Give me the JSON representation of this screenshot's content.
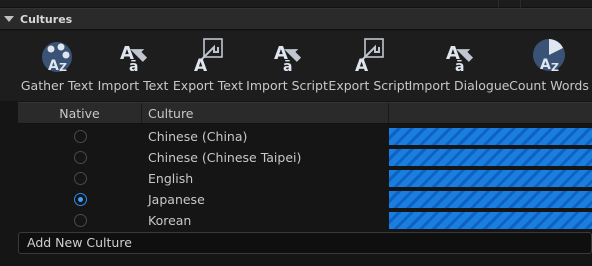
{
  "section": {
    "title": "Cultures"
  },
  "toolbar": {
    "items": [
      {
        "label": "Gather Text",
        "icon": "gather-text-icon"
      },
      {
        "label": "Import Text",
        "icon": "import-text-icon"
      },
      {
        "label": "Export Text",
        "icon": "export-text-icon"
      },
      {
        "label": "Import Script",
        "icon": "import-script-icon"
      },
      {
        "label": "Export Script",
        "icon": "export-script-icon"
      },
      {
        "label": "Import Dialogue",
        "icon": "import-dialogue-icon"
      },
      {
        "label": "Count Words",
        "icon": "count-words-icon"
      }
    ]
  },
  "table": {
    "columns": {
      "native": "Native",
      "culture": "Culture"
    },
    "rows": [
      {
        "culture": "Chinese (China)",
        "native": false,
        "progress": 1.0
      },
      {
        "culture": "Chinese (Chinese Taipei)",
        "native": false,
        "progress": 1.0
      },
      {
        "culture": "English",
        "native": false,
        "progress": 1.0
      },
      {
        "culture": "Japanese",
        "native": true,
        "progress": 1.0
      },
      {
        "culture": "Korean",
        "native": false,
        "progress": 1.0
      }
    ]
  },
  "add_culture": {
    "label": "Add New Culture"
  },
  "colors": {
    "progress": "#1a78d6",
    "radio_checked": "#3aa0ff"
  }
}
